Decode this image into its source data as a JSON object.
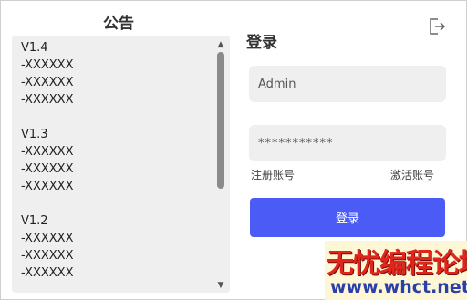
{
  "notice": {
    "title": "公告",
    "content": "V1.4\n-XXXXXX\n-XXXXXX\n-XXXXXX\n\nV1.3\n-XXXXXX\n-XXXXXX\n-XXXXXX\n\nV1.2\n-XXXXXX\n-XXXXXX\n-XXXXXX"
  },
  "login": {
    "title": "登录",
    "username_value": "Admin",
    "password_value": "***********",
    "register_label": "注册账号",
    "activate_label": "激活账号",
    "button_label": "登录"
  },
  "watermark": {
    "text_cn": "无忧编程论坛",
    "url": "www.whct.net"
  },
  "colors": {
    "accent": "#4a5cf5",
    "field_bg": "#efefef"
  }
}
